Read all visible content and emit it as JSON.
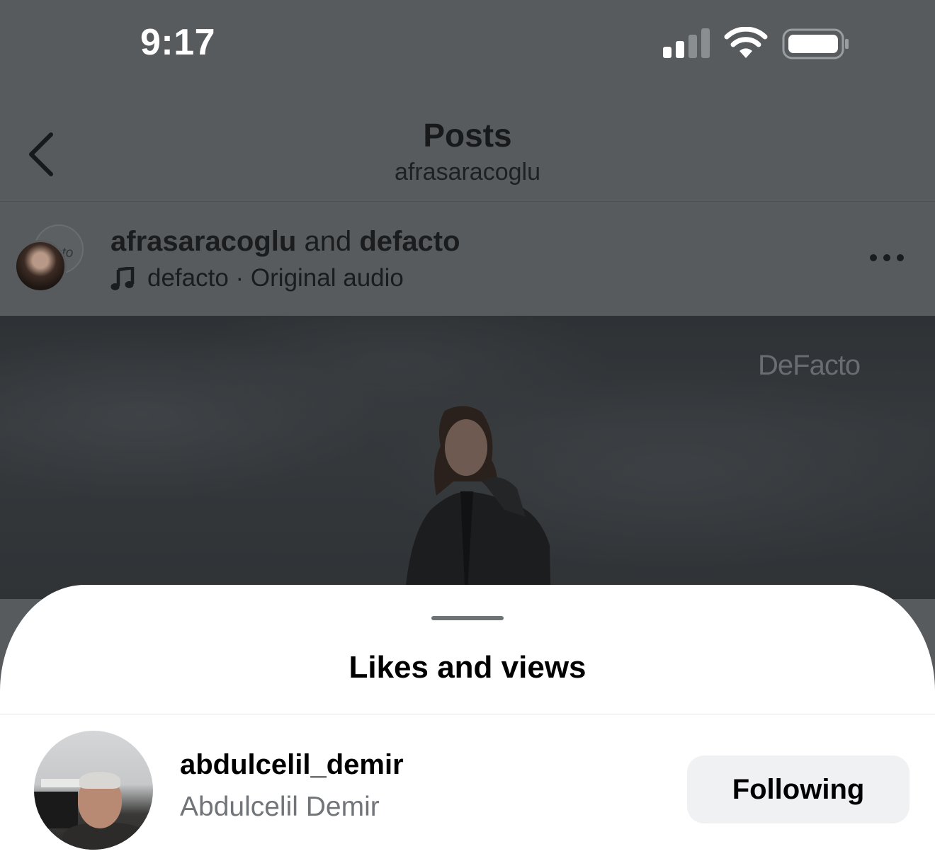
{
  "status_bar": {
    "time": "9:17",
    "icons": [
      "cellular-signal-icon",
      "wifi-icon",
      "battery-icon"
    ]
  },
  "header": {
    "back_icon": "chevron-left-icon",
    "title": "Posts",
    "subtitle": "afrasaracoglu"
  },
  "post": {
    "author_primary": "afrasaracoglu",
    "author_joiner": " and ",
    "author_secondary": "defacto",
    "collab_avatar_text": "cto",
    "audio_icon": "music-note-icon",
    "audio_text": "defacto · Original audio",
    "more_icon": "more-horizontal-icon",
    "media_watermark": "DeFacto"
  },
  "sheet": {
    "title": "Likes and views",
    "users": [
      {
        "username": "abdulcelil_demir",
        "full_name": "Abdulcelil Demir",
        "follow_label": "Following"
      }
    ]
  },
  "colors": {
    "overlay_background": "#575b5e",
    "sheet_background": "#ffffff",
    "button_background": "#eff1f3",
    "secondary_text": "#717479"
  }
}
